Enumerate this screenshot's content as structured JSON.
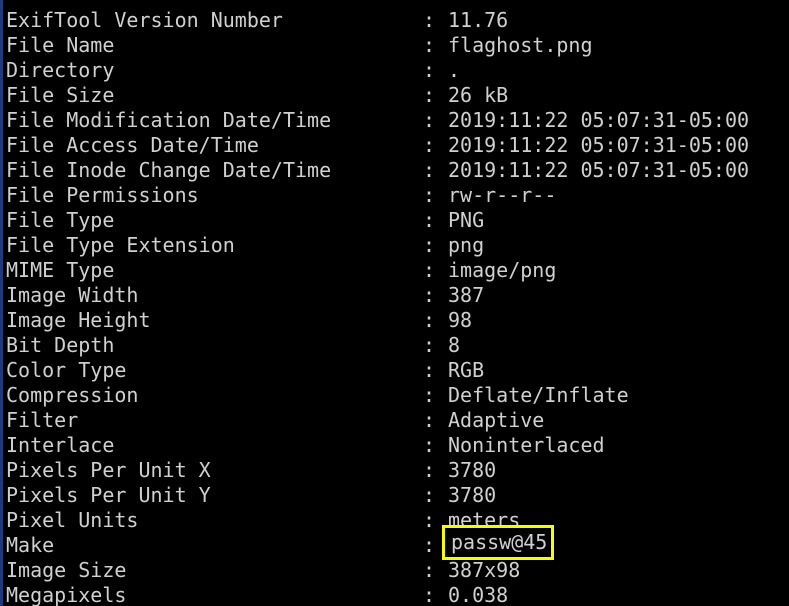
{
  "highlight_color": "#f2ff00",
  "rows": [
    {
      "key": "ExifTool Version Number",
      "sep": ":",
      "value": "11.76"
    },
    {
      "key": "File Name",
      "sep": ":",
      "value": "flaghost.png"
    },
    {
      "key": "Directory",
      "sep": ":",
      "value": "."
    },
    {
      "key": "File Size",
      "sep": ":",
      "value": "26 kB"
    },
    {
      "key": "File Modification Date/Time",
      "sep": ":",
      "value": "2019:11:22 05:07:31-05:00"
    },
    {
      "key": "File Access Date/Time",
      "sep": ":",
      "value": "2019:11:22 05:07:31-05:00"
    },
    {
      "key": "File Inode Change Date/Time",
      "sep": ":",
      "value": "2019:11:22 05:07:31-05:00"
    },
    {
      "key": "File Permissions",
      "sep": ":",
      "value": "rw-r--r--"
    },
    {
      "key": "File Type",
      "sep": ":",
      "value": "PNG"
    },
    {
      "key": "File Type Extension",
      "sep": ":",
      "value": "png"
    },
    {
      "key": "MIME Type",
      "sep": ":",
      "value": "image/png"
    },
    {
      "key": "Image Width",
      "sep": ":",
      "value": "387"
    },
    {
      "key": "Image Height",
      "sep": ":",
      "value": "98"
    },
    {
      "key": "Bit Depth",
      "sep": ":",
      "value": "8"
    },
    {
      "key": "Color Type",
      "sep": ":",
      "value": "RGB"
    },
    {
      "key": "Compression",
      "sep": ":",
      "value": "Deflate/Inflate"
    },
    {
      "key": "Filter",
      "sep": ":",
      "value": "Adaptive"
    },
    {
      "key": "Interlace",
      "sep": ":",
      "value": "Noninterlaced"
    },
    {
      "key": "Pixels Per Unit X",
      "sep": ":",
      "value": "3780"
    },
    {
      "key": "Pixels Per Unit Y",
      "sep": ":",
      "value": "3780"
    },
    {
      "key": "Pixel Units",
      "sep": ":",
      "value": "meters"
    },
    {
      "key": "Make",
      "sep": ":",
      "value": "passw@45",
      "highlighted": true
    },
    {
      "key": "Image Size",
      "sep": ":",
      "value": "387x98"
    },
    {
      "key": "Megapixels",
      "sep": ":",
      "value": "0.038"
    }
  ]
}
